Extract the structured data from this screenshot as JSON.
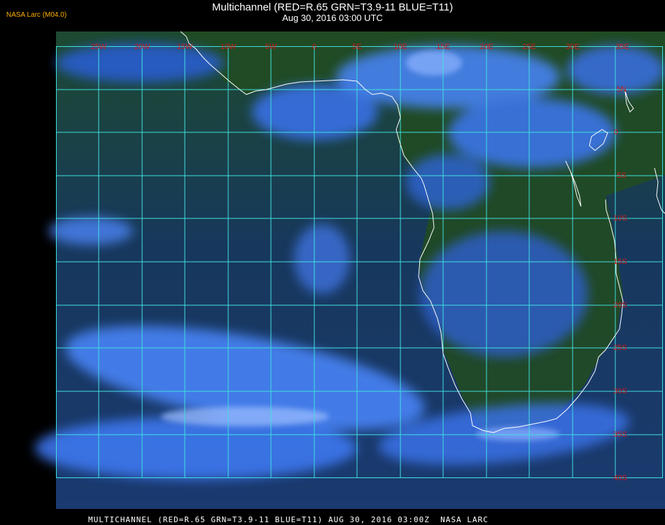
{
  "header": {
    "logo": "NASA Larc (M04.0)",
    "title": "Multichannel (RED=R.65 GRN=T3.9-11 BLUE=T11)",
    "subtitle": "Aug 30, 2016 03:00 UTC"
  },
  "map": {
    "region": "Southern Africa and South Atlantic",
    "top_labels": [
      "25W",
      "20W",
      "15W",
      "10W",
      "5W",
      "0",
      "5E",
      "10E",
      "15E",
      "20E",
      "25E",
      "30E",
      "35E"
    ],
    "right_labels": [
      "5N",
      "0",
      "5S",
      "10S",
      "15S",
      "20S",
      "25S",
      "30S",
      "35S",
      "40S"
    ],
    "colors": {
      "grid": "#40e0e0",
      "coastline": "#ffffff",
      "label": "#cc1a1a",
      "land": "#1f4a22",
      "ocean": "#163a5a",
      "cloud": "#3d7fff"
    }
  },
  "footer": {
    "text": "MULTICHANNEL (RED=R.65 GRN=T3.9-11 BLUE=T11) AUG 30, 2016 03:00Z  NASA LARC"
  }
}
